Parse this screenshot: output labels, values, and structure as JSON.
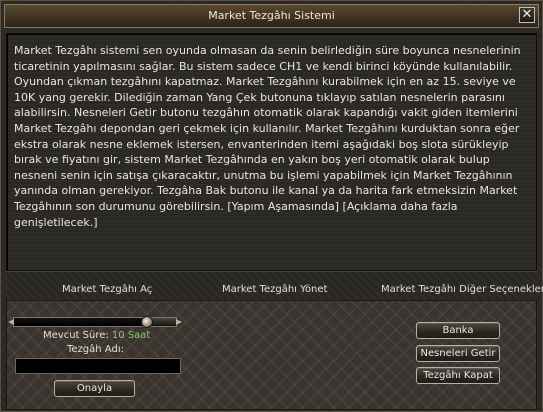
{
  "window": {
    "title": "Market Tezgâhı Sistemi",
    "close_glyph": "✕"
  },
  "description": "Market Tezgâhı sistemi sen oyunda olmasan da senin belirlediğin süre boyunca nesnelerinin ticaretinin yapılmasını sağlar. Bu sistem sadece CH1 ve kendi birinci köyünde kullanılabilir. Oyundan çıkman tezgâhını kapatmaz. Market Tezgâhını kurabilmek için en az 15. seviye ve 10K yang gerekir. Dilediğin zaman Yang Çek butonuna tıklayıp satılan nesnelerin parasını alabilirsin. Nesneleri Getir butonu tezgâhın otomatik olarak kapandığı vakit giden itemlerini Market Tezgâhı depondan geri çekmek için kullanılır. Market Tezgâhını kurduktan sonra eğer ekstra olarak nesne eklemek istersen, envanterinden itemi aşağıdaki boş slota sürükleyip bırak ve fiyatını gir, sistem Market Tezgâhında en yakın boş yeri otomatik olarak bulup nesneni senin için satışa çıkaracaktır, unutma bu işlemi yapabilmek için Market Tezgâhının yanında olman gerekiyor. Tezgâha Bak butonu ile kanal ya da harita fark etmeksizin Market Tezgâhının son durumunu görebilirsin. [Yapım Aşamasında] [Açıklama daha fazla genişletilecek.]",
  "tabs": {
    "open": "Market Tezgâhı Aç",
    "manage": "Market Tezgâhı Yönet",
    "other": "Market Tezgâhı Diğer Seçenekler"
  },
  "setup": {
    "duration_label": "Mevcut Süre:",
    "duration_value": "10 Saat",
    "duration_fraction": 0.82,
    "name_label": "Tezgâh Adı:",
    "name_value": "",
    "approve_label": "Onayla"
  },
  "actions": {
    "bank": "Banka",
    "fetch_items": "Nesneleri Getir",
    "close_stall": "Tezgâhı Kapat"
  },
  "colors": {
    "title_bar": "#3e3222",
    "duration_value": "#79d95e"
  },
  "icons": {
    "close": "close-icon",
    "slider_knob": "slider-knob"
  }
}
